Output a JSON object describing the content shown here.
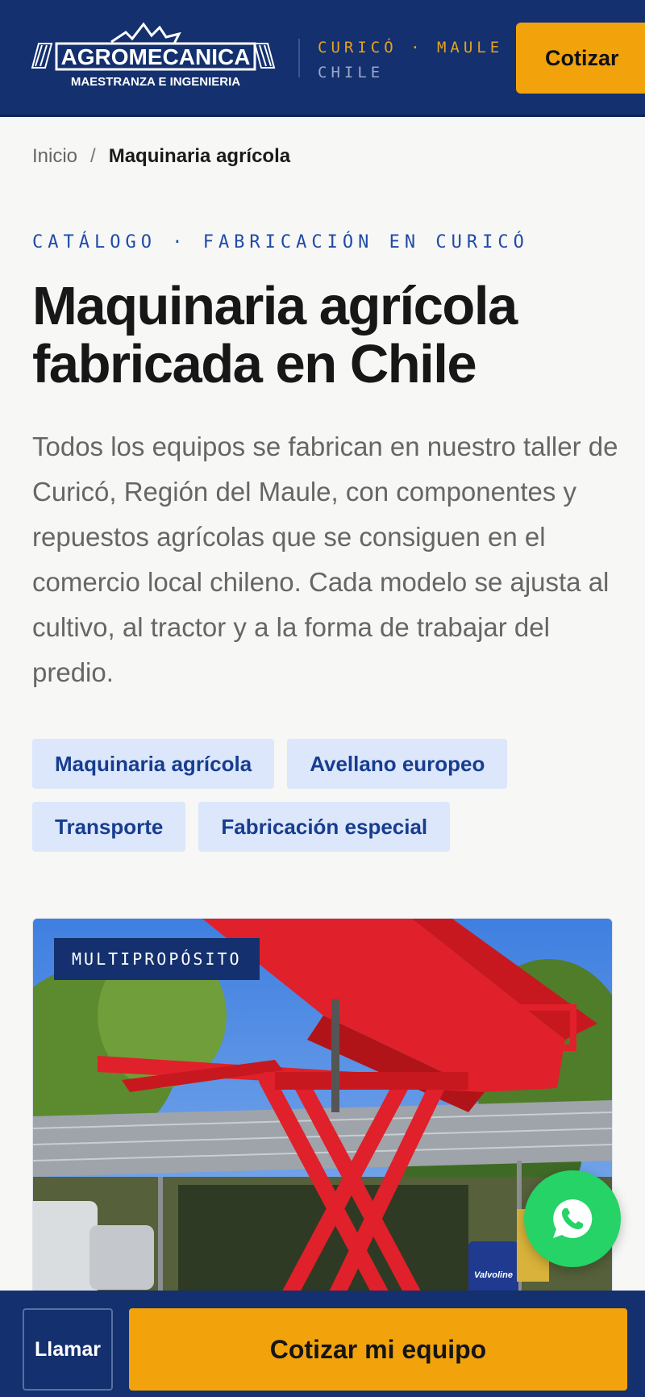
{
  "header": {
    "logo_title": "AGROMECANICA",
    "logo_subtitle": "MAESTRANZA E INGENIERIA",
    "location_line1": "CURICÓ · MAULE",
    "location_line2": "CHILE",
    "cta_label": "Cotizar"
  },
  "breadcrumb": {
    "home": "Inicio",
    "separator": "/",
    "current": "Maquinaria agrícola"
  },
  "hero": {
    "eyebrow": "CATÁLOGO · FABRICACIÓN EN CURICÓ",
    "title": "Maquinaria agrícola fabricada en Chile",
    "intro": "Todos los equipos se fabrican en nuestro taller de Curicó, Región del Maule, con componentes y repuestos agrícolas que se consiguen en el comercio local chileno. Cada modelo se ajusta al cultivo, al tractor y a la forma de trabajar del predio."
  },
  "filters": [
    {
      "label": "Maquinaria agrícola"
    },
    {
      "label": "Avellano europeo"
    },
    {
      "label": "Transporte"
    },
    {
      "label": "Fabricación especial"
    }
  ],
  "product_card": {
    "badge": "MULTIPROPÓSITO",
    "image_text": "Valvoline"
  },
  "bottom_bar": {
    "call_label": "Llamar",
    "quote_label": "Cotizar mi equipo"
  },
  "colors": {
    "navy": "#14306e",
    "accent": "#f2a30c",
    "chip_bg": "#dce7fb",
    "whatsapp": "#25d366"
  },
  "icons": {
    "whatsapp": "whatsapp-icon"
  }
}
